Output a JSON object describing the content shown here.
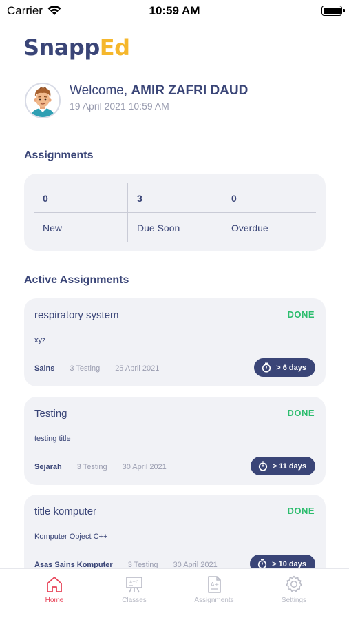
{
  "status_bar": {
    "carrier": "Carrier",
    "time": "10:59 AM"
  },
  "app": {
    "logo_part1": "Snapp",
    "logo_part2": "Ed",
    "brand_color": "#3a4577",
    "accent_color": "#f5b72c"
  },
  "header": {
    "welcome_prefix": "Welcome,",
    "user_name": "AMIR ZAFRI DAUD",
    "datetime": "19 April 2021 10:59 AM"
  },
  "assignments_summary": {
    "title": "Assignments",
    "items": [
      {
        "count": "0",
        "label": "New"
      },
      {
        "count": "3",
        "label": "Due Soon"
      },
      {
        "count": "0",
        "label": "Overdue"
      }
    ]
  },
  "active_assignments": {
    "title": "Active Assignments",
    "items": [
      {
        "title": "respiratory system",
        "status": "DONE",
        "description": "xyz",
        "subject": "Sains",
        "class": "3 Testing",
        "due_date": "25 April 2021",
        "remaining": "> 6 days"
      },
      {
        "title": "Testing",
        "status": "DONE",
        "description": "testing title",
        "subject": "Sejarah",
        "class": "3 Testing",
        "due_date": "30 April 2021",
        "remaining": "> 11 days"
      },
      {
        "title": "title komputer",
        "status": "DONE",
        "description": "Komputer Object C++",
        "subject": "Asas Sains Komputer",
        "class": "3 Testing",
        "due_date": "30 April 2021",
        "remaining": "> 10 days"
      }
    ]
  },
  "tab_bar": {
    "active_color": "#e8455a",
    "items": [
      {
        "label": "Home",
        "icon": "home-icon",
        "active": true
      },
      {
        "label": "Classes",
        "icon": "classes-icon",
        "active": false
      },
      {
        "label": "Assignments",
        "icon": "assignments-icon",
        "active": false
      },
      {
        "label": "Settings",
        "icon": "settings-icon",
        "active": false
      }
    ]
  }
}
